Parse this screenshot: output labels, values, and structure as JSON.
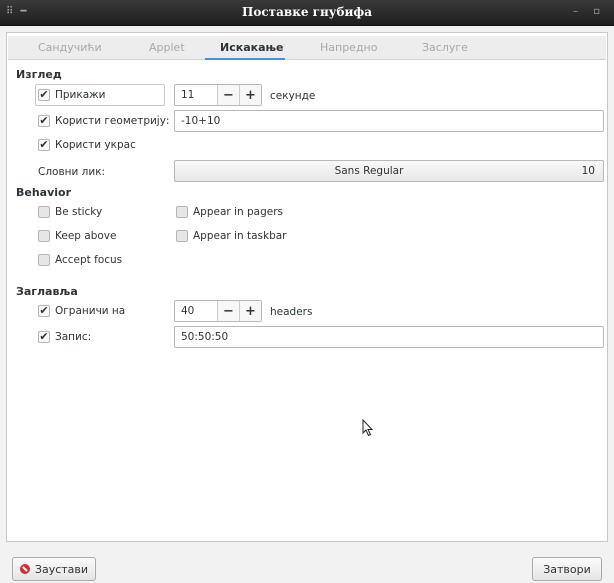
{
  "window": {
    "title": "Поставке гнубифа",
    "left_controls": "⠿ ━",
    "right_controls": "– ▫"
  },
  "tabs": [
    {
      "label": "Сандучићи"
    },
    {
      "label": "Applet"
    },
    {
      "label": "Искакање"
    },
    {
      "label": "Напредно"
    },
    {
      "label": "Заслуге"
    }
  ],
  "appearance": {
    "heading": "Изглед",
    "show": {
      "label": "Прикажи",
      "checked": true
    },
    "seconds": {
      "value": "11",
      "minus": "−",
      "plus": "+",
      "unit": "секунде"
    },
    "geometry": {
      "label": "Користи геометрију:",
      "checked": true,
      "value": "-10+10"
    },
    "decoration": {
      "label": "Користи украс",
      "checked": true
    },
    "font": {
      "label": "Словни лик:",
      "name": "Sans Regular",
      "size": "10"
    }
  },
  "behavior": {
    "heading": "Behavior",
    "sticky": {
      "label": "Be sticky",
      "checked": false
    },
    "pagers": {
      "label": "Appear in pagers",
      "checked": false
    },
    "above": {
      "label": "Keep above",
      "checked": false
    },
    "taskbar": {
      "label": "Appear in taskbar",
      "checked": false
    },
    "focus": {
      "label": "Accept focus",
      "checked": false
    }
  },
  "headers": {
    "heading": "Заглавља",
    "limit": {
      "label": "Ограничи на",
      "checked": true
    },
    "count": {
      "value": "40",
      "minus": "−",
      "plus": "+",
      "unit": "headers"
    },
    "format": {
      "label": "Запис:",
      "checked": true,
      "value": "50:50:50"
    }
  },
  "footer": {
    "stop_label": "Заустави",
    "close_label": "Затвори"
  },
  "check_glyph": "✔"
}
